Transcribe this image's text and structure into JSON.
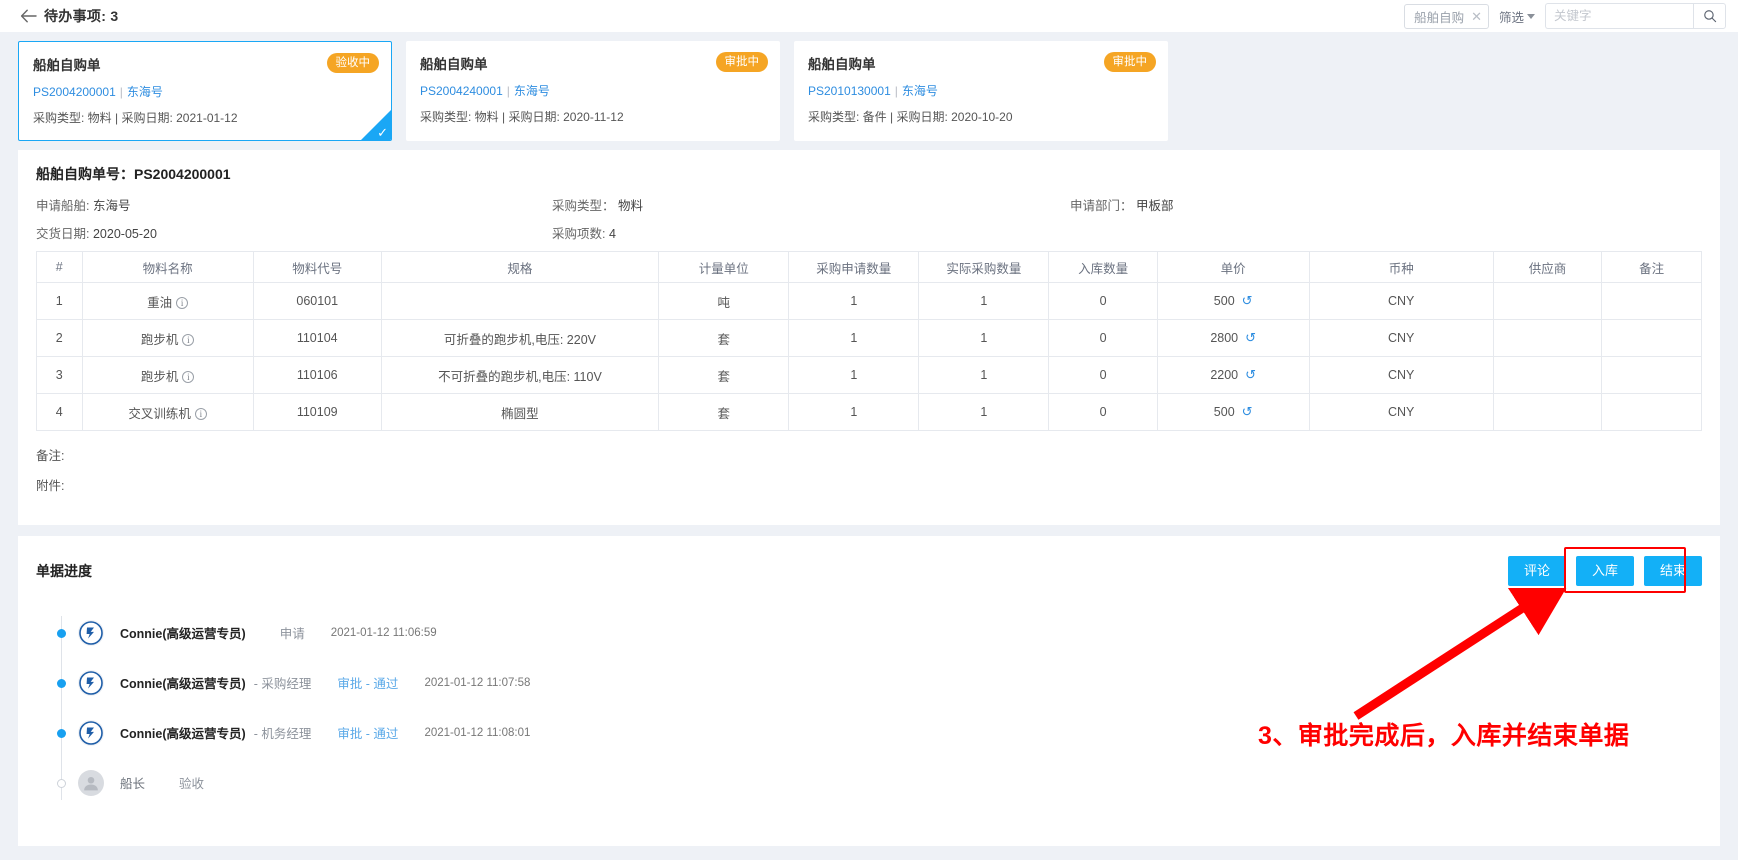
{
  "topbar": {
    "back_icon": "back-arrow-icon",
    "title": "待办事项: 3",
    "filter_tag": "船舶自购",
    "filter_tag_close": "✕",
    "filter_label": "筛选",
    "search_placeholder": "关键字",
    "search_value": "",
    "search_icon": "search-icon"
  },
  "cards": [
    {
      "title": "船舶自购单",
      "code": "PS2004200001",
      "separator": "|",
      "ship": "东海号",
      "info": "采购类型: 物料 | 采购日期: 2021-01-12",
      "status": "验收中",
      "selected": true
    },
    {
      "title": "船舶自购单",
      "code": "PS2004240001",
      "separator": "|",
      "ship": "东海号",
      "info": "采购类型: 物料 | 采购日期: 2020-11-12",
      "status": "审批中",
      "selected": false
    },
    {
      "title": "船舶自购单",
      "code": "PS2010130001",
      "separator": "|",
      "ship": "东海号",
      "info": "采购类型: 备件 | 采购日期: 2020-10-20",
      "status": "审批中",
      "selected": false
    }
  ],
  "detail": {
    "doc_no_label": "船舶自购单号：",
    "doc_no_value": "PS2004200001",
    "fields": [
      {
        "label": "申请船舶:",
        "value": "东海号"
      },
      {
        "label": "采购类型：",
        "value": "物料"
      },
      {
        "label": "申请部门：",
        "value": "甲板部"
      },
      {
        "label": "交货日期:",
        "value": "2020-05-20"
      },
      {
        "label": "采购项数:",
        "value": "4"
      }
    ],
    "table": {
      "headers": [
        "#",
        "物料名称",
        "物料代号",
        "规格",
        "计量单位",
        "采购申请数量",
        "实际采购数量",
        "入库数量",
        "单价",
        "币种",
        "供应商",
        "备注"
      ],
      "rows": [
        {
          "idx": "1",
          "name": "重油",
          "code": "060101",
          "spec": "",
          "unit": "吨",
          "req_qty": "1",
          "act_qty": "1",
          "in_qty": "0",
          "price": "500",
          "currency": "CNY",
          "supplier": "",
          "remark": ""
        },
        {
          "idx": "2",
          "name": "跑步机",
          "code": "110104",
          "spec": "可折叠的跑步机,电压: 220V",
          "unit": "套",
          "req_qty": "1",
          "act_qty": "1",
          "in_qty": "0",
          "price": "2800",
          "currency": "CNY",
          "supplier": "",
          "remark": ""
        },
        {
          "idx": "3",
          "name": "跑步机",
          "code": "110106",
          "spec": "不可折叠的跑步机,电压: 110V",
          "unit": "套",
          "req_qty": "1",
          "act_qty": "1",
          "in_qty": "0",
          "price": "2200",
          "currency": "CNY",
          "supplier": "",
          "remark": ""
        },
        {
          "idx": "4",
          "name": "交叉训练机",
          "code": "110109",
          "spec": "椭圆型",
          "unit": "套",
          "req_qty": "1",
          "act_qty": "1",
          "in_qty": "0",
          "price": "500",
          "currency": "CNY",
          "supplier": "",
          "remark": ""
        }
      ]
    },
    "remark_label": "备注:",
    "attachment_label": "附件:"
  },
  "progress": {
    "title": "单据进度",
    "buttons": {
      "comment": "评论",
      "stock_in": "入库",
      "finish": "结束"
    },
    "timeline": [
      {
        "name": "Connie(高级运营专员)",
        "role": "",
        "action": "申请",
        "time": "2021-01-12 11:06:59",
        "action_blue": false,
        "pending": false
      },
      {
        "name": "Connie(高级运营专员)",
        "role": "- 采购经理",
        "action": "审批 - 通过",
        "time": "2021-01-12 11:07:58",
        "action_blue": true,
        "pending": false
      },
      {
        "name": "Connie(高级运营专员)",
        "role": "- 机务经理",
        "action": "审批 - 通过",
        "time": "2021-01-12 11:08:01",
        "action_blue": true,
        "pending": false
      },
      {
        "name": "船长",
        "role": "",
        "action": "验收",
        "time": "",
        "action_blue": false,
        "pending": true
      }
    ]
  },
  "annotation": {
    "text": "3、审批完成后，入库并结束单据",
    "color": "#ff0000"
  }
}
